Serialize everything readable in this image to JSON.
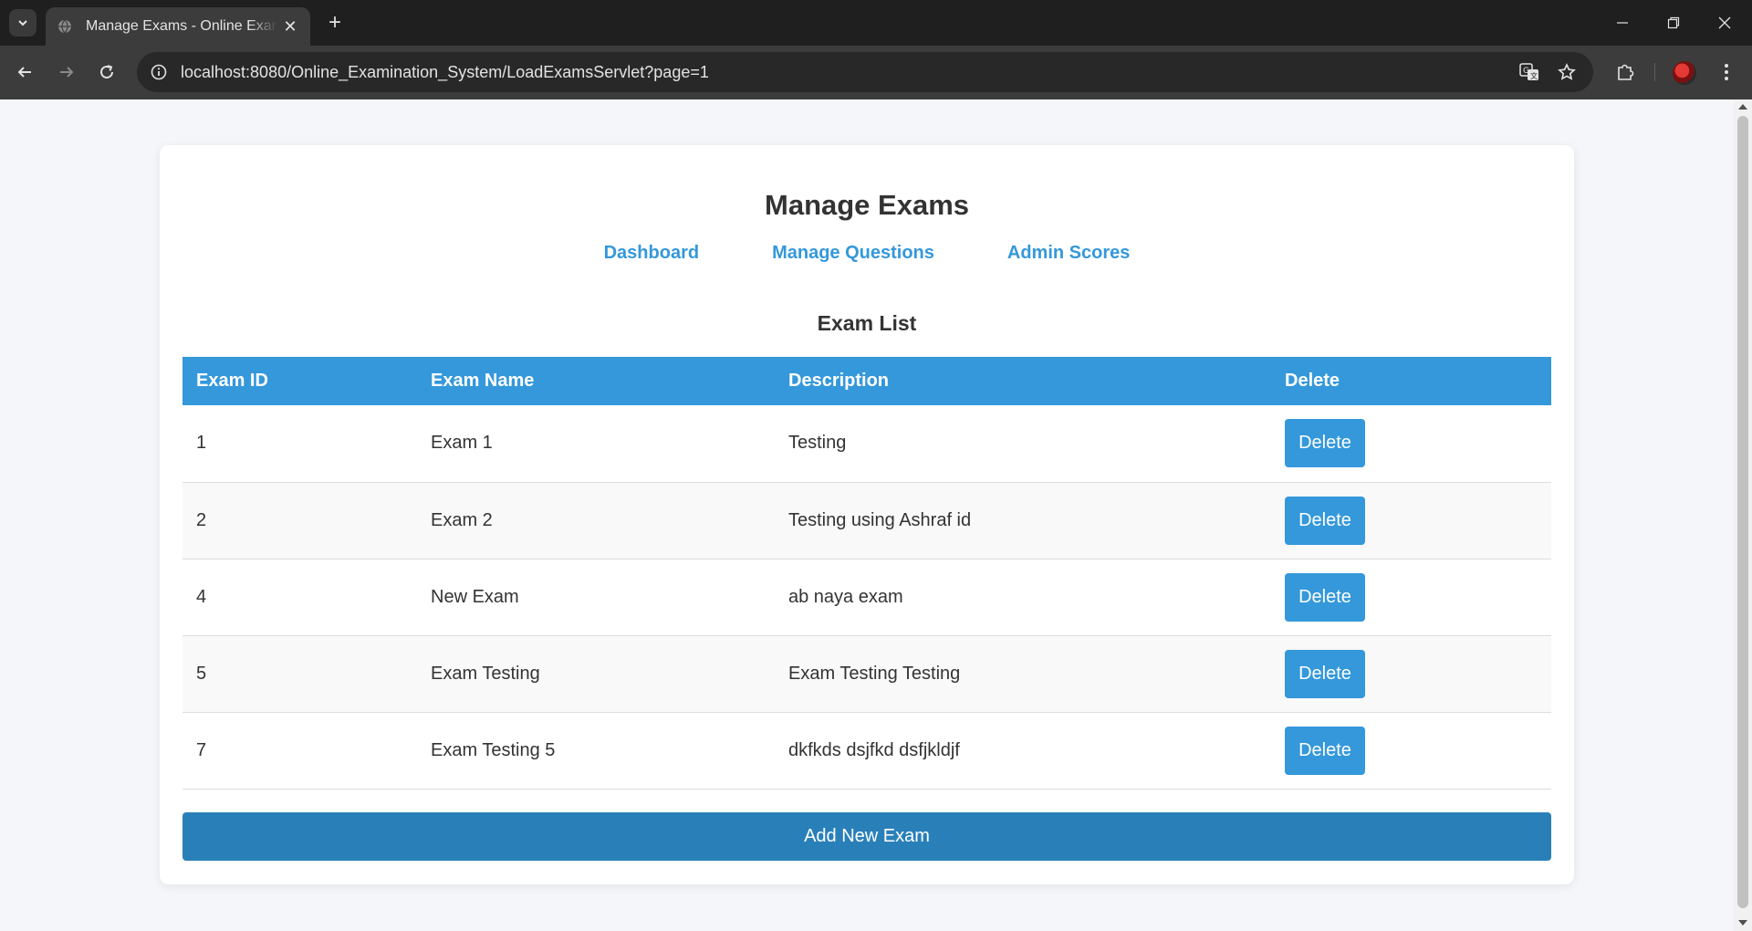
{
  "browser": {
    "tab_title": "Manage Exams - Online Examination System",
    "url": "localhost:8080/Online_Examination_System/LoadExamsServlet?page=1",
    "icons": {
      "tab_search": "chevron-down-icon",
      "favicon": "globe-icon",
      "close_tab": "close-icon",
      "new_tab": "plus-icon",
      "back": "arrow-left-icon",
      "forward": "arrow-right-icon",
      "reload": "reload-icon",
      "site_info": "info-icon",
      "translate": "translate-icon",
      "bookmark": "star-icon",
      "extensions": "puzzle-icon",
      "menu": "kebab-menu-icon",
      "minimize": "minimize-icon",
      "restore": "restore-icon",
      "close_window": "close-icon"
    }
  },
  "page": {
    "title": "Manage Exams",
    "nav": [
      {
        "label": "Dashboard"
      },
      {
        "label": "Manage Questions"
      },
      {
        "label": "Admin Scores"
      }
    ],
    "section_title": "Exam List",
    "table": {
      "headers": [
        "Exam ID",
        "Exam Name",
        "Description",
        "Delete"
      ],
      "rows": [
        {
          "id": "1",
          "name": "Exam 1",
          "description": "Testing",
          "action": "Delete"
        },
        {
          "id": "2",
          "name": "Exam 2",
          "description": "Testing using Ashraf id",
          "action": "Delete"
        },
        {
          "id": "4",
          "name": "New Exam",
          "description": "ab naya exam",
          "action": "Delete"
        },
        {
          "id": "5",
          "name": "Exam Testing",
          "description": "Exam Testing Testing",
          "action": "Delete"
        },
        {
          "id": "7",
          "name": "Exam Testing 5",
          "description": "dkfkds dsjfkd dsfjkldjf",
          "action": "Delete"
        }
      ]
    },
    "add_button": "Add New Exam"
  },
  "colors": {
    "primary": "#3498db",
    "primary_dark": "#2980b9",
    "text": "#333333",
    "background": "#f4f6f9"
  }
}
